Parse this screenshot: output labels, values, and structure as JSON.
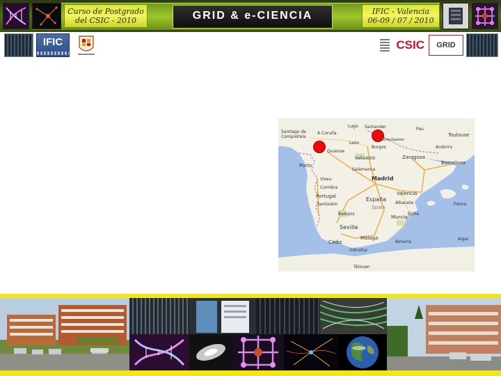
{
  "header": {
    "course_line1": "Curso de Postgrado",
    "course_line2": "del CSIC - 2010",
    "title": "GRID & e-CIENCIA",
    "place_line1": "IFIC - Valencia",
    "place_line2": "06-09 / 07 / 2010"
  },
  "logos": {
    "ific": "IFIC",
    "csic": "CSIC",
    "grid": "GRID"
  },
  "map": {
    "labels": {
      "santiago": "Santiago de Compostela",
      "coruna": "A Coruña",
      "lugo": "Lugo",
      "santander": "Santander",
      "pau": "Pau",
      "toulouse": "Toulouse",
      "ourense": "Ourense",
      "leon": "León",
      "burgos": "Burgos",
      "vitoria": "Vitoria-Gasteiz",
      "andorra": "Andorra",
      "zaragoza": "Zaragoza",
      "porto": "Porto",
      "valladolid": "Valladolid",
      "barcelona": "Barcelona",
      "salamanca": "Salamanca",
      "viseu": "Viseu",
      "madrid": "Madrid",
      "coimbra": "Coimbra",
      "portugal": "Portugal",
      "valencia": "Valencia",
      "espana": "España",
      "santarem": "Santarém",
      "spain": "Spain",
      "albacete": "Albacete",
      "palma": "Palma",
      "badajoz": "Badajoz",
      "murcia": "Murcia",
      "elche": "Elche",
      "sevilla": "Sevilla",
      "cadiz": "Cádiz",
      "malaga": "Málaga",
      "almeria": "Almería",
      "gibraltar": "Gibraltar",
      "alger": "Alger",
      "tetouan": "Tétouan"
    }
  },
  "colors": {
    "banner_green": "#9dc62b",
    "banner_yellow": "#f2f560",
    "title_bg": "#111111",
    "marker_red": "#ee0a0a",
    "stripe_yellow": "#f2e617",
    "csic_red": "#c8102e"
  }
}
